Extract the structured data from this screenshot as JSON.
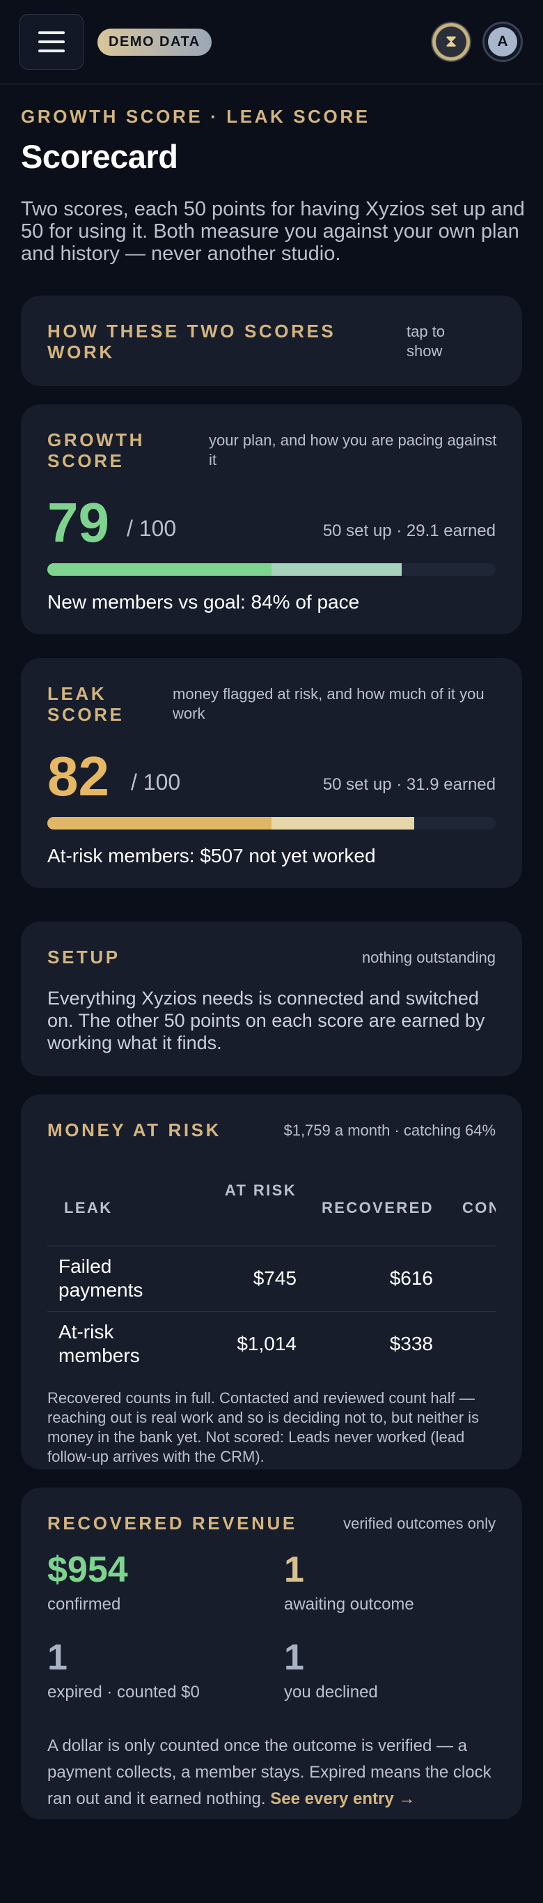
{
  "topbar": {
    "badge": "DEMO DATA",
    "hourglass_glyph": "⧗",
    "avatar_initial": "A"
  },
  "header": {
    "eyebrow": "GROWTH SCORE · LEAK SCORE",
    "title": "Scorecard",
    "intro": "Two scores, each 50 points for having Xyzios set up and 50 for using it. Both measure you against your own plan and history — never another studio."
  },
  "how": {
    "title": "HOW THESE TWO SCORES WORK",
    "toggle": "tap to show"
  },
  "growth": {
    "title": "GROWTH SCORE",
    "aside": "your plan, and how you are pacing against it",
    "score": "79",
    "denominator": "/ 100",
    "split": "50 set up · 29.1 earned",
    "setup_points": 50,
    "earned_points": 29.1,
    "footer": "New members vs goal: 84% of pace",
    "color_setup": "#7ed48f",
    "color_earned": "#a7d3bd",
    "score_color": "#7ed48f"
  },
  "leak": {
    "title": "LEAK SCORE",
    "aside": "money flagged at risk, and how much of it you work",
    "score": "82",
    "denominator": "/ 100",
    "split": "50 set up · 31.9 earned",
    "setup_points": 50,
    "earned_points": 31.9,
    "footer": "At-risk members: $507 not yet worked",
    "color_setup": "#e0b865",
    "color_earned": "#e6d6a8",
    "score_color": "#e7b864"
  },
  "setup": {
    "title": "SETUP",
    "status": "nothing outstanding",
    "body": "Everything Xyzios needs is connected and switched on. The other 50 points on each score are earned by working what it finds."
  },
  "risk": {
    "title": "MONEY AT RISK",
    "summary": "$1,759 a month · catching 64%",
    "columns": [
      "LEAK",
      "AT RISK",
      "RECOVERED",
      "CONTACTED"
    ],
    "rows": [
      {
        "leak": "Failed payments",
        "at_risk": "$745",
        "recovered": "$616"
      },
      {
        "leak": "At-risk members",
        "at_risk": "$1,014",
        "recovered": "$338"
      }
    ],
    "note": "Recovered counts in full. Contacted and reviewed count half — reaching out is real work and so is deciding not to, but neither is money in the bank yet. Not scored: Leads never worked (lead follow-up arrives with the CRM)."
  },
  "recovered": {
    "title": "RECOVERED REVENUE",
    "aside": "verified outcomes only",
    "stats": [
      {
        "value": "$954",
        "label": "confirmed",
        "color": "#7ed48f"
      },
      {
        "value": "1",
        "label": "awaiting outcome",
        "color": "#d9c08f"
      },
      {
        "value": "1",
        "label": "expired · counted $0",
        "color": "#a9b2c3"
      },
      {
        "value": "1",
        "label": "you declined",
        "color": "#a9b2c3"
      }
    ],
    "note": "A dollar is only counted once the outcome is verified — a payment collects, a member stays. Expired means the clock ran out and it earned nothing.",
    "link": "See every entry →"
  }
}
